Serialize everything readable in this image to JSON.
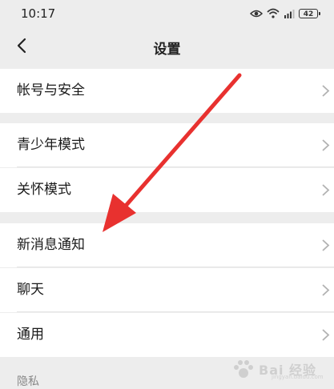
{
  "status_bar": {
    "time": "10:17",
    "battery": "42",
    "icons": [
      "eye-icon",
      "wifi-icon",
      "signal-icon",
      "battery-icon"
    ]
  },
  "header": {
    "title": "设置",
    "back_icon": "chevron-left-icon"
  },
  "settings": {
    "account": "帐号与安全",
    "youth_mode": "青少年模式",
    "care_mode": "关怀模式",
    "notifications": "新消息通知",
    "chat": "聊天",
    "general": "通用",
    "privacy_partial": "隐私"
  },
  "annotation": {
    "arrow_color": "#e8312f"
  },
  "watermark": {
    "text": "Bai 经验",
    "sub": "jingyan.baidu.com"
  }
}
